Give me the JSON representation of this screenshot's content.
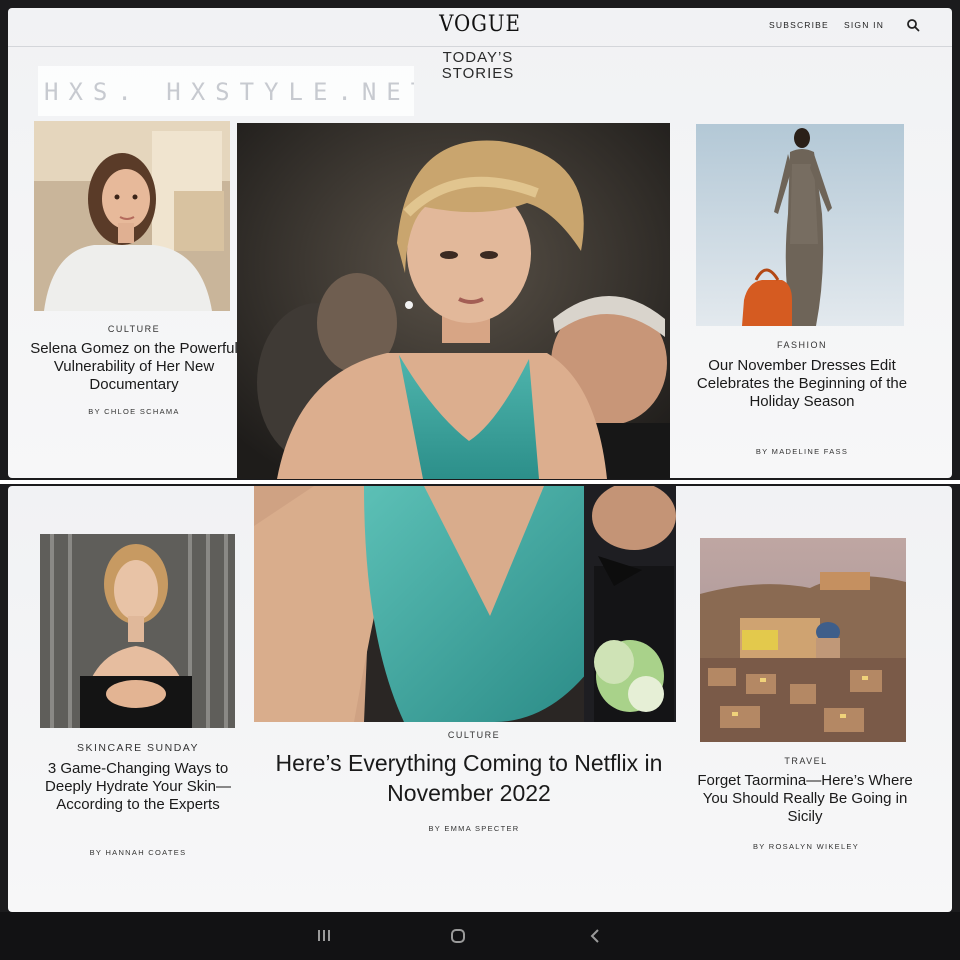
{
  "header": {
    "logo": "VOGUE",
    "subscribe_label": "SUBSCRIBE",
    "sign_in_label": "SIGN IN",
    "section_heading_line1": "TODAY’S",
    "section_heading_line2": "STORIES"
  },
  "watermark": {
    "text": "HXS. HXSTYLE.NET"
  },
  "stories_top": [
    {
      "kicker": "CULTURE",
      "headline": "Selena Gomez on the Powerful Vulnerability of Her New Documentary",
      "byline": "BY CHLOE SCHAMA",
      "image": "portrait-photo"
    },
    {
      "image": "feature-photo-top"
    },
    {
      "kicker": "FASHION",
      "headline": "Our November Dresses Edit Celebrates the Beginning of the Holiday Season",
      "byline": "BY MADELINE FASS",
      "image": "dress-photo"
    }
  ],
  "stories_bottom": [
    {
      "kicker": "SKINCARE SUNDAY",
      "headline": "3 Game-Changing Ways to Deeply Hydrate Your Skin—According to the Experts",
      "byline": "BY HANNAH COATES",
      "image": "model-photo"
    },
    {
      "kicker": "CULTURE",
      "headline": "Here’s Everything Coming to Netflix in November 2022",
      "byline": "BY EMMA SPECTER",
      "image": "feature-photo-bottom"
    },
    {
      "kicker": "TRAVEL",
      "headline": "Forget Taormina—Here’s Where You Should Really Be Going in Sicily",
      "byline": "BY ROSALYN WIKELEY",
      "image": "sicily-photo"
    }
  ],
  "system_nav": {
    "recents_icon": "recent-apps-icon",
    "home_icon": "home-icon",
    "back_icon": "back-icon"
  },
  "colors": {
    "page_bg": "#f4f5f6",
    "frame": "#1b1b1d",
    "dress": "#2f9c96",
    "text": "#1a1a1a"
  }
}
